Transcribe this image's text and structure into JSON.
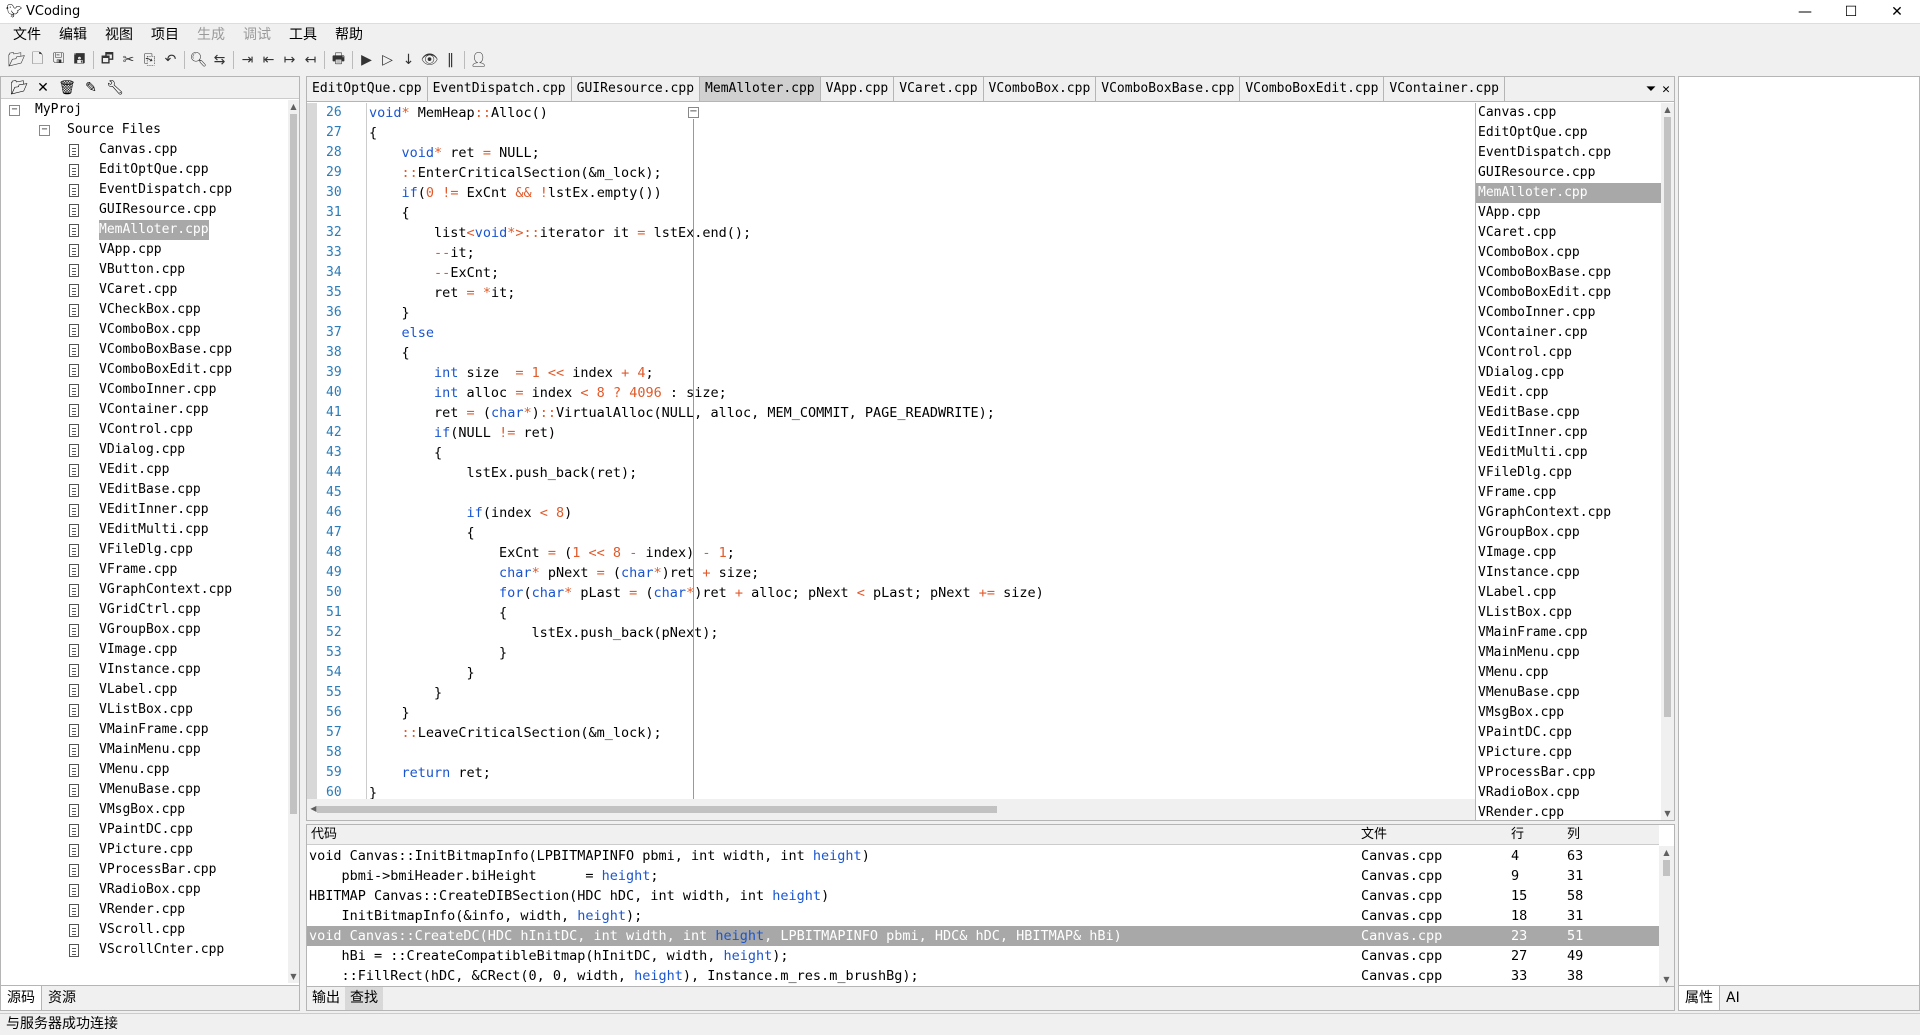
{
  "window": {
    "title": "VCoding",
    "app_icon": "bird-icon"
  },
  "menu": [
    "文件",
    "编辑",
    "视图",
    "项目",
    "生成",
    "调试",
    "工具",
    "帮助"
  ],
  "menu_disabled": [
    false,
    false,
    false,
    false,
    true,
    true,
    false,
    false
  ],
  "toolbar_icons": [
    "open-project-icon",
    "new-file-icon",
    "save-icon",
    "save-all-icon",
    "sep",
    "copy-window-icon",
    "cut-icon",
    "copy-icon",
    "undo-icon",
    "sep",
    "find-icon",
    "replace-icon",
    "sep",
    "indent-icon",
    "unindent-icon",
    "goto-icon",
    "back-icon",
    "sep",
    "build-icon",
    "sep",
    "run-icon",
    "run-outline-icon",
    "step-icon",
    "watch-icon",
    "pause-icon",
    "sep",
    "user-icon"
  ],
  "project": {
    "root": "MyProj",
    "folder": "Source Files",
    "files": [
      "Canvas.cpp",
      "EditOptQue.cpp",
      "EventDispatch.cpp",
      "GUIResource.cpp",
      "MemAlloter.cpp",
      "VApp.cpp",
      "VButton.cpp",
      "VCaret.cpp",
      "VCheckBox.cpp",
      "VComboBox.cpp",
      "VComboBoxBase.cpp",
      "VComboBoxEdit.cpp",
      "VComboInner.cpp",
      "VContainer.cpp",
      "VControl.cpp",
      "VDialog.cpp",
      "VEdit.cpp",
      "VEditBase.cpp",
      "VEditInner.cpp",
      "VEditMulti.cpp",
      "VFileDlg.cpp",
      "VFrame.cpp",
      "VGraphContext.cpp",
      "VGridCtrl.cpp",
      "VGroupBox.cpp",
      "VImage.cpp",
      "VInstance.cpp",
      "VLabel.cpp",
      "VListBox.cpp",
      "VMainFrame.cpp",
      "VMainMenu.cpp",
      "VMenu.cpp",
      "VMenuBase.cpp",
      "VMsgBox.cpp",
      "VPaintDC.cpp",
      "VPicture.cpp",
      "VProcessBar.cpp",
      "VRadioBox.cpp",
      "VRender.cpp",
      "VScroll.cpp",
      "VScrollCnter.cpp"
    ],
    "selected": "MemAlloter.cpp"
  },
  "left_tabs": [
    "源码",
    "资源"
  ],
  "editor_tabs": [
    "EditOptQue.cpp",
    "EventDispatch.cpp",
    "GUIResource.cpp",
    "MemAlloter.cpp",
    "VApp.cpp",
    "VCaret.cpp",
    "VComboBox.cpp",
    "VComboBoxBase.cpp",
    "VComboBoxEdit.cpp",
    "VContainer.cpp"
  ],
  "active_tab": "MemAlloter.cpp",
  "line_numbers": [
    "26",
    "27",
    "28",
    "29",
    "30",
    "31",
    "32",
    "33",
    "34",
    "35",
    "36",
    "37",
    "38",
    "39",
    "40",
    "41",
    "42",
    "43",
    "44",
    "45",
    "46",
    "47",
    "48",
    "49",
    "50",
    "51",
    "52",
    "53",
    "54",
    "55",
    "56",
    "57",
    "58",
    "59",
    "60"
  ],
  "code_lines": [
    "void* MemHeap::Alloc()",
    "{",
    "    void* ret = NULL;",
    "    ::EnterCriticalSection(&m_lock);",
    "    if(0 != ExCnt && !lstEx.empty())",
    "    {",
    "        list<void*>::iterator it = lstEx.end();",
    "        --it;",
    "        --ExCnt;",
    "        ret = *it;",
    "    }",
    "    else",
    "    {",
    "        int size  = 1 << index + 4;",
    "        int alloc = index < 8 ? 4096 : size;",
    "        ret = (char*)::VirtualAlloc(NULL, alloc, MEM_COMMIT, PAGE_READWRITE);",
    "        if(NULL != ret)",
    "        {",
    "            lstEx.push_back(ret);",
    "",
    "            if(index < 8)",
    "            {",
    "                ExCnt = (1 << 8 - index) - 1;",
    "                char* pNext = (char*)ret + size;",
    "                for(char* pLast = (char*)ret + alloc; pNext < pLast; pNext += size)",
    "                {",
    "                    lstEx.push_back(pNext);",
    "                }",
    "            }",
    "        }",
    "    }",
    "    ::LeaveCriticalSection(&m_lock);",
    "",
    "    return ret;",
    "}"
  ],
  "open_files": [
    "Canvas.cpp",
    "EditOptQue.cpp",
    "EventDispatch.cpp",
    "GUIResource.cpp",
    "MemAlloter.cpp",
    "VApp.cpp",
    "VCaret.cpp",
    "VComboBox.cpp",
    "VComboBoxBase.cpp",
    "VComboBoxEdit.cpp",
    "VComboInner.cpp",
    "VContainer.cpp",
    "VControl.cpp",
    "VDialog.cpp",
    "VEdit.cpp",
    "VEditBase.cpp",
    "VEditInner.cpp",
    "VEditMulti.cpp",
    "VFileDlg.cpp",
    "VFrame.cpp",
    "VGraphContext.cpp",
    "VGroupBox.cpp",
    "VImage.cpp",
    "VInstance.cpp",
    "VLabel.cpp",
    "VListBox.cpp",
    "VMainFrame.cpp",
    "VMainMenu.cpp",
    "VMenu.cpp",
    "VMenuBase.cpp",
    "VMsgBox.cpp",
    "VPaintDC.cpp",
    "VPicture.cpp",
    "VProcessBar.cpp",
    "VRadioBox.cpp",
    "VRender.cpp"
  ],
  "search_results": {
    "headers": {
      "code": "代码",
      "file": "文件",
      "line": "行",
      "col": "列"
    },
    "rows": [
      {
        "pre": "void Canvas::InitBitmapInfo(LPBITMAPINFO pbmi, int width, int ",
        "hl": "height",
        "post": ")",
        "file": "Canvas.cpp",
        "line": "4",
        "col": "63"
      },
      {
        "pre": "    pbmi->bmiHeader.biHeight      = ",
        "hl": "height",
        "post": ";",
        "file": "Canvas.cpp",
        "line": "9",
        "col": "31"
      },
      {
        "pre": "HBITMAP Canvas::CreateDIBSection(HDC hDC, int width, int ",
        "hl": "height",
        "post": ")",
        "file": "Canvas.cpp",
        "line": "15",
        "col": "58"
      },
      {
        "pre": "    InitBitmapInfo(&info, width, ",
        "hl": "height",
        "post": ");",
        "file": "Canvas.cpp",
        "line": "18",
        "col": "31"
      },
      {
        "pre": "void Canvas::CreateDC(HDC hInitDC, int width, int ",
        "hl": "height",
        "post": ", LPBITMAPINFO pbmi, HDC& hDC, HBITMAP& hBi)",
        "file": "Canvas.cpp",
        "line": "23",
        "col": "51"
      },
      {
        "pre": "    hBi = ::CreateCompatibleBitmap(hInitDC, width, ",
        "hl": "height",
        "post": ");",
        "file": "Canvas.cpp",
        "line": "27",
        "col": "49"
      },
      {
        "pre": "    ::FillRect(hDC, &CRect(0, 0, width, ",
        "hl": "height",
        "post": "), Instance.m_res.m_brushBg);",
        "file": "Canvas.cpp",
        "line": "33",
        "col": "38"
      }
    ],
    "selected_index": 4
  },
  "bottom_tabs": [
    "输出",
    "查找"
  ],
  "right_tabs": [
    "属性",
    "AI"
  ],
  "status": "与服务器成功连接",
  "colors": {
    "keyword": "#1a55d0",
    "number": "#e05a2a",
    "line_number": "#2b7bb9",
    "selection": "#a8a8a8"
  }
}
